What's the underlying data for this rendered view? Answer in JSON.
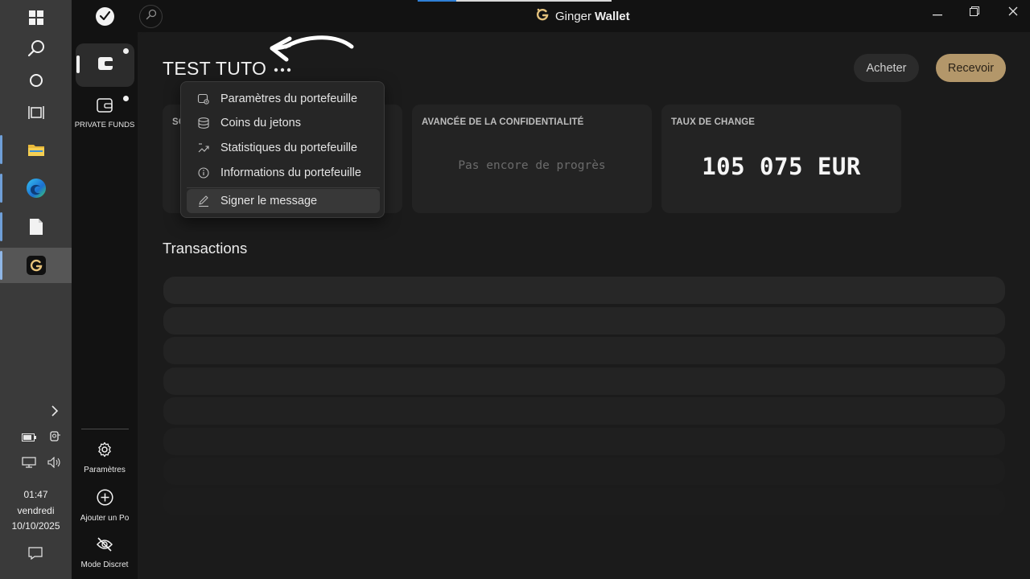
{
  "window": {
    "app_name_light": "Ginger",
    "app_name_bold": "Wallet",
    "accent_color": "#b3976a"
  },
  "taskbar": {
    "items": [
      "windows-icon",
      "search-icon",
      "cortana-icon",
      "task-view-icon",
      "file-explorer-icon",
      "edge-icon",
      "notepad-icon",
      "ginger-wallet-icon"
    ],
    "time": "01:47",
    "day": "vendredi",
    "date": "10/10/2025"
  },
  "sidebar": {
    "private_funds_label": "PRIVATE FUNDS",
    "settings_label": "Paramètres",
    "add_wallet_label": "Ajouter un Po",
    "discreet_label": "Mode Discret"
  },
  "wallet": {
    "name": "TEST TUTO",
    "buy_label": "Acheter",
    "receive_label": "Recevoir"
  },
  "tiles": {
    "balance_label_partial": "SO",
    "privacy_label": "AVANCÉE DE LA CONFIDENTIALITÉ",
    "privacy_value": "Pas encore de progrès",
    "exchange_label": "TAUX DE CHANGE",
    "exchange_value": "105 075 EUR"
  },
  "transactions": {
    "title": "Transactions",
    "placeholder_rows": 8
  },
  "menu": {
    "items": [
      {
        "label": "Paramètres du portefeuille",
        "icon": "wallet-settings-icon"
      },
      {
        "label": "Coins du jetons",
        "icon": "coins-icon"
      },
      {
        "label": "Statistiques du portefeuille",
        "icon": "statistics-icon"
      },
      {
        "label": "Informations du portefeuille",
        "icon": "info-icon"
      },
      {
        "label": "Signer le message",
        "icon": "sign-pen-icon"
      }
    ]
  }
}
